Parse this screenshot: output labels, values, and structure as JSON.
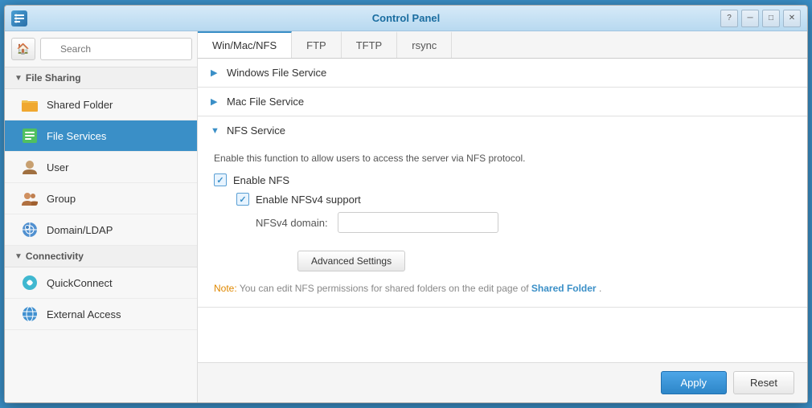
{
  "window": {
    "title": "Control Panel",
    "app_icon": "⚙"
  },
  "titlebar": {
    "help_btn": "?",
    "minimize_btn": "─",
    "maximize_btn": "□",
    "close_btn": "✕"
  },
  "sidebar": {
    "search_placeholder": "Search",
    "sections": [
      {
        "id": "file-sharing",
        "label": "File Sharing",
        "collapsed": false,
        "items": [
          {
            "id": "shared-folder",
            "label": "Shared Folder",
            "icon": "shared-folder",
            "active": false
          },
          {
            "id": "file-services",
            "label": "File Services",
            "icon": "file-services",
            "active": true
          }
        ]
      },
      {
        "id": "connectivity",
        "label": "Connectivity",
        "collapsed": false,
        "items": [
          {
            "id": "quickconnect",
            "label": "QuickConnect",
            "icon": "quickconnect",
            "active": false
          },
          {
            "id": "external-access",
            "label": "External Access",
            "icon": "external",
            "active": false
          }
        ]
      },
      {
        "id": "user-group",
        "label": null,
        "items": [
          {
            "id": "user",
            "label": "User",
            "icon": "user",
            "active": false
          },
          {
            "id": "group",
            "label": "Group",
            "icon": "group",
            "active": false
          },
          {
            "id": "domain-ldap",
            "label": "Domain/LDAP",
            "icon": "domain",
            "active": false
          }
        ]
      }
    ]
  },
  "tabs": [
    {
      "id": "win-mac-nfs",
      "label": "Win/Mac/NFS",
      "active": true
    },
    {
      "id": "ftp",
      "label": "FTP",
      "active": false
    },
    {
      "id": "tftp",
      "label": "TFTP",
      "active": false
    },
    {
      "id": "rsync",
      "label": "rsync",
      "active": false
    }
  ],
  "sections": {
    "windows_file_service": {
      "label": "Windows File Service",
      "expanded": false,
      "arrow": "▶"
    },
    "mac_file_service": {
      "label": "Mac File Service",
      "expanded": false,
      "arrow": "▶"
    },
    "nfs_service": {
      "label": "NFS Service",
      "expanded": true,
      "arrow": "▼",
      "description": "Enable this function to allow users to access the server via NFS protocol.",
      "enable_nfs_label": "Enable NFS",
      "enable_nfsv4_label": "Enable NFSv4 support",
      "nfsv4_domain_label": "NFSv4 domain:",
      "nfsv4_domain_value": "",
      "advanced_settings_label": "Advanced Settings",
      "note_prefix": "Note:",
      "note_text": " You can edit NFS permissions for shared folders on the edit page of ",
      "note_link": "Shared Folder",
      "note_suffix": ".",
      "enable_nfs_checked": true,
      "enable_nfsv4_checked": true
    }
  },
  "footer": {
    "apply_label": "Apply",
    "reset_label": "Reset"
  }
}
